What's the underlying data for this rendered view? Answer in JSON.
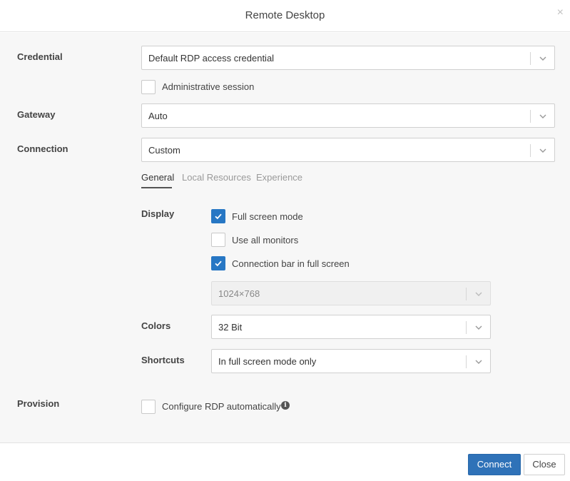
{
  "dialog": {
    "title": "Remote Desktop",
    "close_icon": "×"
  },
  "form": {
    "credential": {
      "label": "Credential",
      "value": "Default RDP access credential"
    },
    "admin_session": {
      "label": "Administrative session",
      "checked": false
    },
    "gateway": {
      "label": "Gateway",
      "value": "Auto"
    },
    "connection": {
      "label": "Connection",
      "value": "Custom"
    },
    "tabs": [
      {
        "label": "General",
        "active": true
      },
      {
        "label": "Local Resources",
        "active": false
      },
      {
        "label": "Experience",
        "active": false
      }
    ],
    "display": {
      "label": "Display",
      "options": [
        {
          "label": "Full screen mode",
          "checked": true
        },
        {
          "label": "Use all monitors",
          "checked": false
        },
        {
          "label": "Connection bar in full screen",
          "checked": true
        }
      ],
      "resolution": "1024×768"
    },
    "colors": {
      "label": "Colors",
      "value": "32 Bit"
    },
    "shortcuts": {
      "label": "Shortcuts",
      "value": "In full screen mode only"
    },
    "provision": {
      "label": "Provision",
      "option_label": "Configure RDP automatically",
      "checked": false,
      "info_icon": "i"
    }
  },
  "footer": {
    "connect_label": "Connect",
    "close_label": "Close"
  },
  "colors": {
    "accent": "#2777c4",
    "primary_button": "#2f72b8"
  }
}
